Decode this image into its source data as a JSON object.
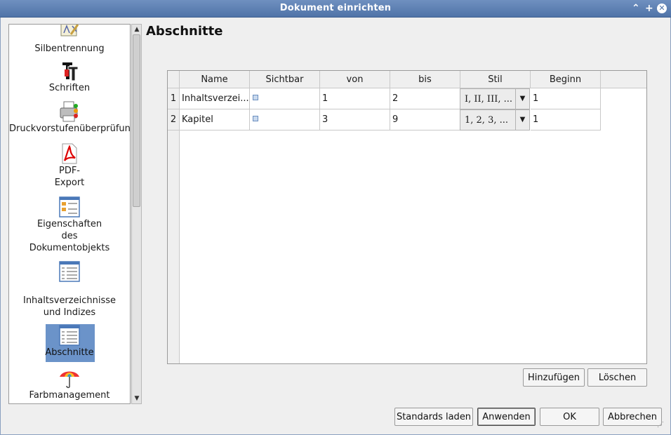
{
  "window": {
    "title": "Dokument einrichten",
    "controls": {
      "minimize": "⌃",
      "maximize": "+",
      "close": "✕"
    }
  },
  "sidebar": {
    "items": [
      {
        "label": "Silbentrennung",
        "icon": "hyphenation-icon"
      },
      {
        "label": "Schriften",
        "icon": "fonts-icon"
      },
      {
        "label": "Druckvorstufenüberprüfung",
        "icon": "preflight-printer-icon"
      },
      {
        "label_lines": [
          "PDF-",
          "Export"
        ],
        "icon": "pdf-icon"
      },
      {
        "label_lines": [
          "Eigenschaften",
          "des",
          "Dokumentobjekts"
        ],
        "icon": "document-properties-icon"
      },
      {
        "label_lines": [
          "Inhaltsverzeichnisse",
          "und Indizes"
        ],
        "icon": "toc-icon"
      },
      {
        "label": "Abschnitte",
        "icon": "sections-icon",
        "selected": true
      },
      {
        "label": "Farbmanagement",
        "icon": "color-management-icon"
      }
    ]
  },
  "main": {
    "heading": "Abschnitte",
    "table": {
      "columns": [
        "Name",
        "Sichtbar",
        "von",
        "bis",
        "Stil",
        "Beginn"
      ],
      "rows": [
        {
          "num": "1",
          "name": "Inhaltsverzei...",
          "visible": true,
          "from": "1",
          "to": "2",
          "style": "I, II, III, ...",
          "start": "1"
        },
        {
          "num": "2",
          "name": "Kapitel",
          "visible": true,
          "from": "3",
          "to": "9",
          "style": "1, 2, 3, ...",
          "start": "1"
        }
      ]
    },
    "buttons": {
      "add": "Hinzufügen",
      "delete": "Löschen"
    }
  },
  "footer": {
    "load_defaults": "Standards laden",
    "apply": "Anwenden",
    "ok": "OK",
    "cancel": "Abbrechen"
  },
  "colors": {
    "titlebar": "#4f73a8",
    "selection": "#6b93c9"
  }
}
